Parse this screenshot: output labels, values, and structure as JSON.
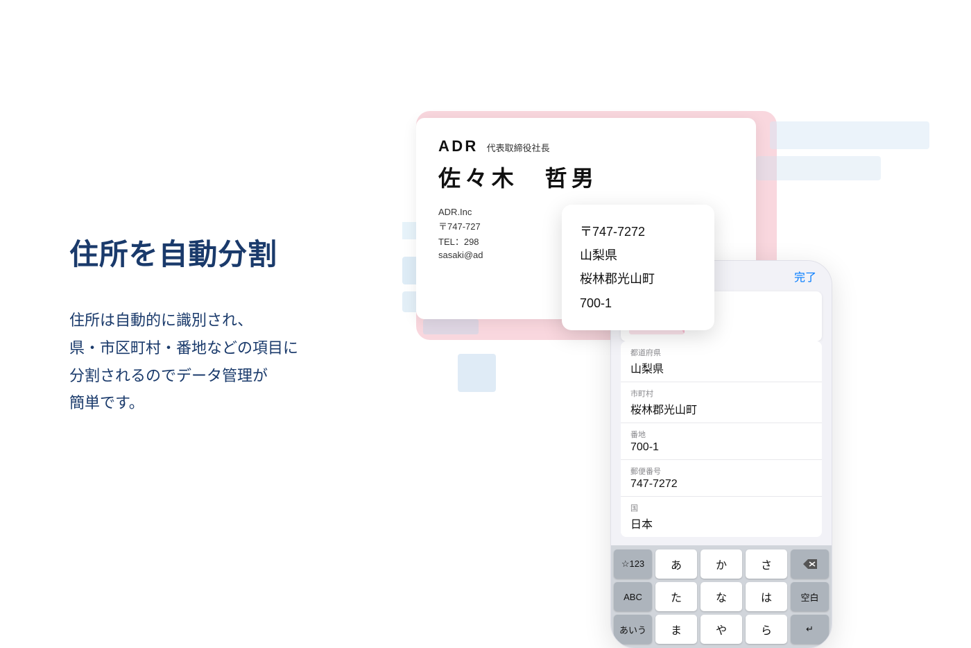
{
  "left": {
    "title": "住所を自動分割",
    "description_lines": [
      "住所は自動的に識別され、",
      "県・市区町村・番地などの項目に",
      "分割されるのでデータ管理が",
      "簡単です。"
    ]
  },
  "business_card": {
    "company": "ADR",
    "position": "代表取締役社長",
    "name": "佐々木　哲男",
    "detail1": "ADR.Inc",
    "detail2": "〒747-727",
    "detail3": "TEL：298",
    "detail4": "sasaki@ad"
  },
  "address_popup": {
    "line1": "〒747-7272",
    "line2": "山梨県",
    "line3": "桜林郡光山町",
    "line4": "700-1"
  },
  "phone": {
    "done_label": "完了",
    "fields": [
      {
        "label": "都道府県",
        "value": "山梨県"
      },
      {
        "label": "市町村",
        "value": "桜林郡光山町"
      },
      {
        "label": "番地",
        "value": "700-1"
      },
      {
        "label": "郵便番号",
        "value": "747-7272"
      },
      {
        "label": "国",
        "value": "日本"
      }
    ],
    "keyboard": {
      "row1": [
        "☆123",
        "あ",
        "か",
        "さ",
        "⌫"
      ],
      "row2": [
        "ABC",
        "た",
        "な",
        "は",
        "空白"
      ],
      "row3": [
        "あいう",
        "ま",
        "や",
        "ら",
        ""
      ]
    }
  }
}
